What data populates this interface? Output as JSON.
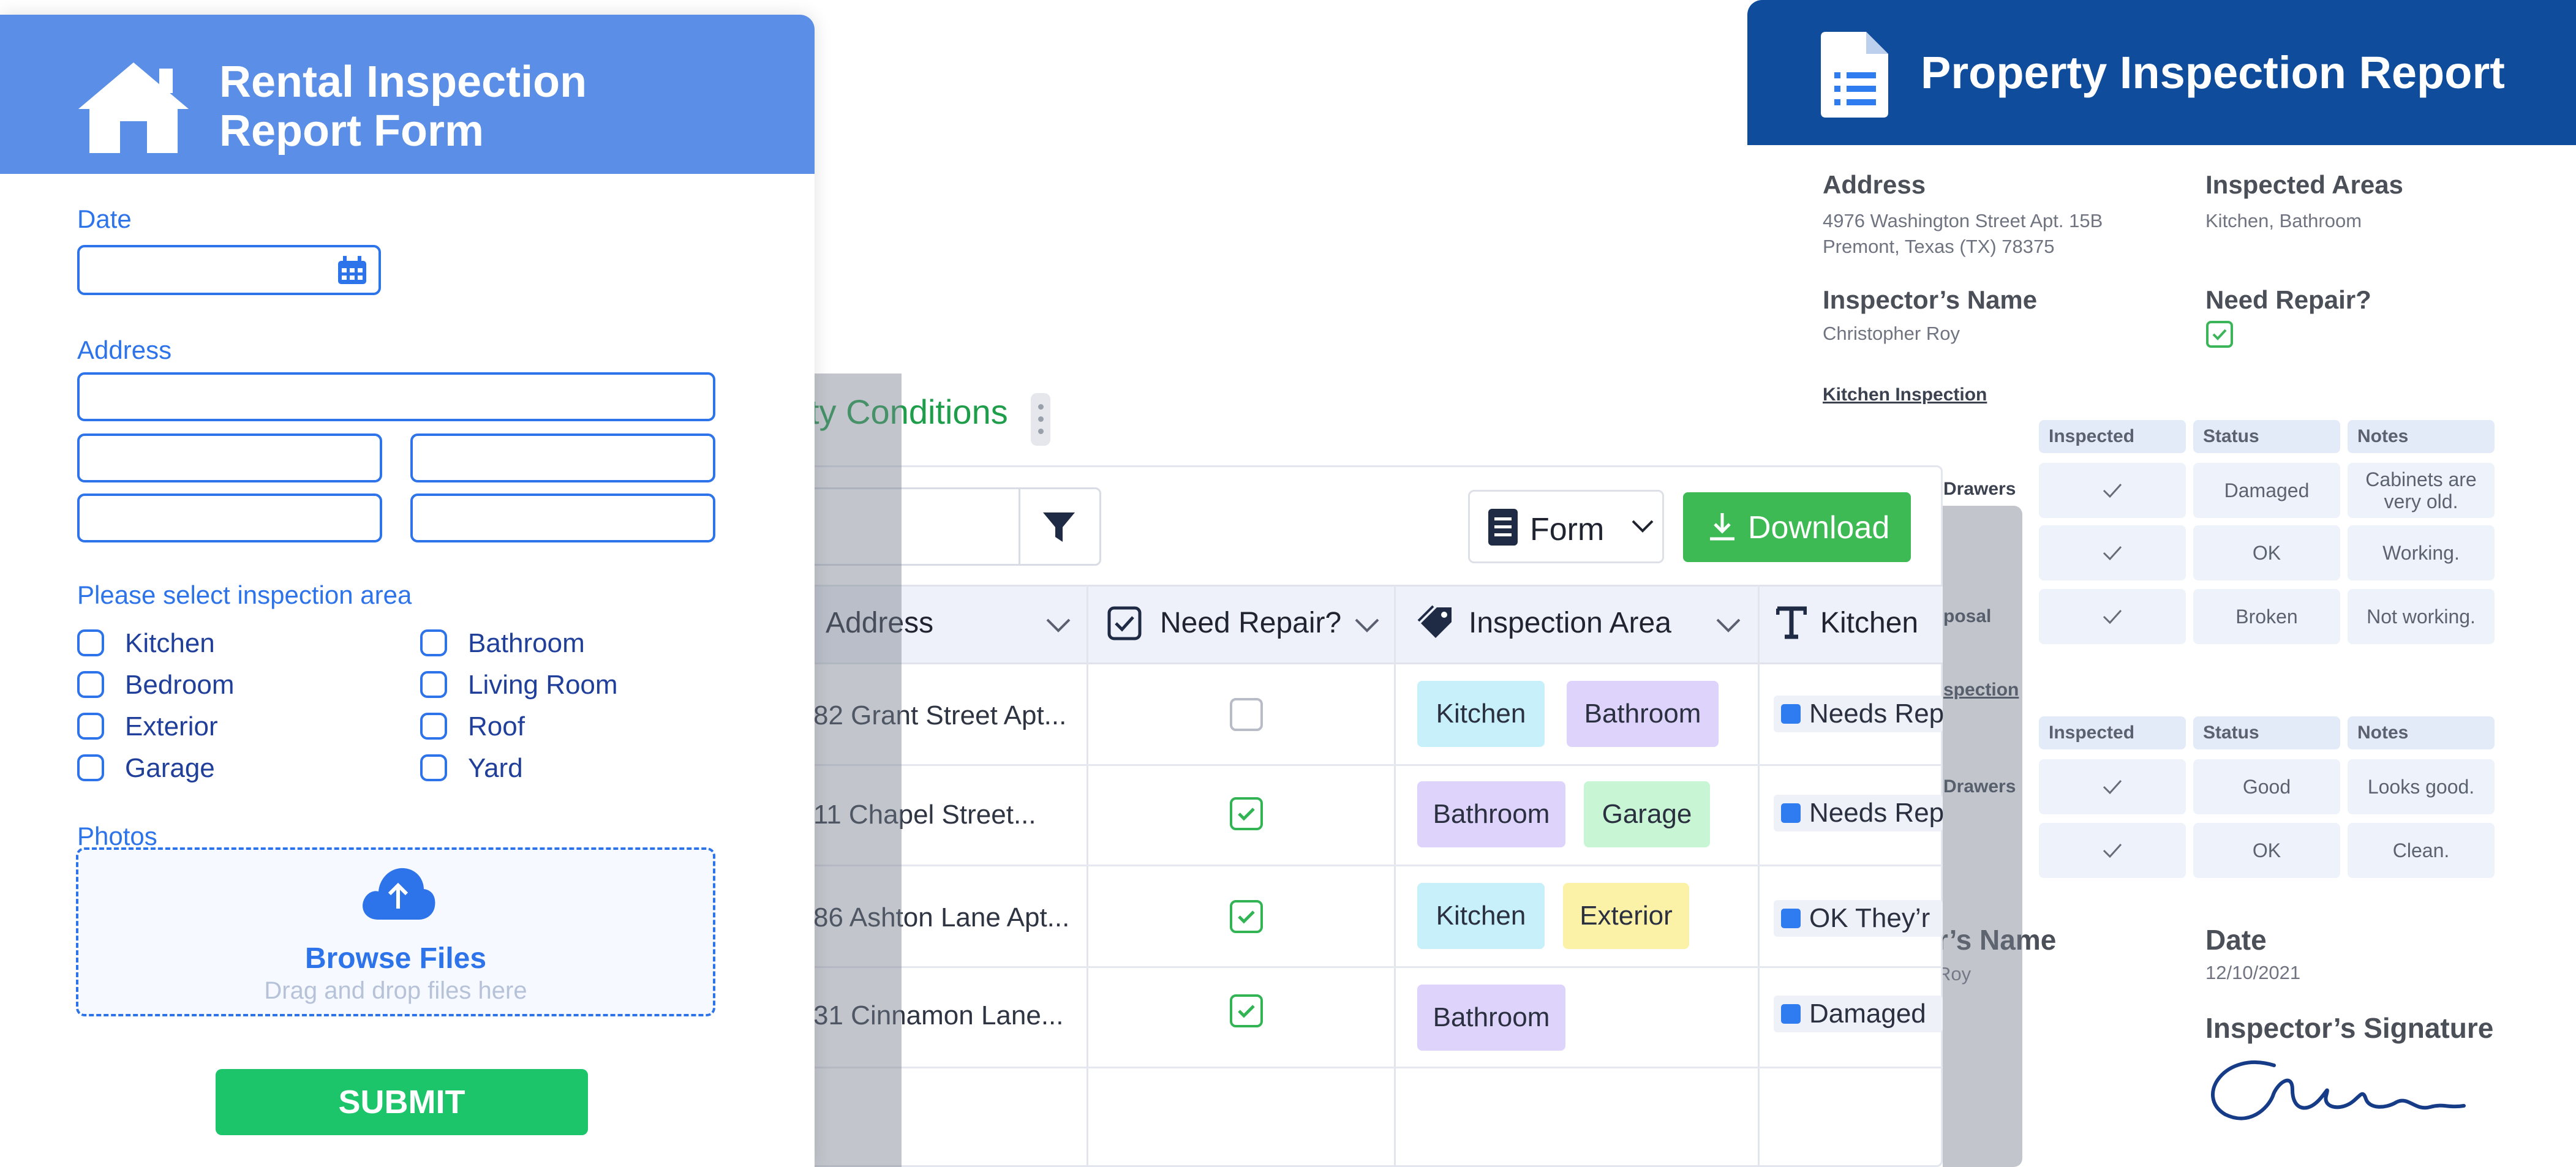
{
  "report": {
    "title": "Property Inspection Report",
    "address_label": "Address",
    "address_line1": "4976 Washington Street Apt. 15B",
    "address_line2": "Premont, Texas (TX) 78375",
    "inspected_areas_label": "Inspected Areas",
    "inspected_areas": "Kitchen, Bathroom",
    "inspector_name_label": "Inspector’s Name",
    "inspector_name": "Christopher Roy",
    "need_repair_label": "Need Repair?",
    "kitchen_section": "Kitchen Inspection",
    "col_inspected": "Inspected",
    "col_status": "Status",
    "col_notes": "Notes",
    "kitchen_rows": [
      {
        "item": "Drawers",
        "status": "Damaged",
        "notes": "Cabinets are very old."
      },
      {
        "item": "",
        "status": "OK",
        "notes": "Working."
      },
      {
        "item": "posal",
        "status": "Broken",
        "notes": "Not working."
      }
    ],
    "bathroom_section": "spection",
    "bathroom_rows": [
      {
        "item": "Drawers",
        "status": "Good",
        "notes": "Looks good."
      },
      {
        "item": "",
        "status": "OK",
        "notes": "Clean."
      }
    ],
    "inspector_name_label2": "r’s Name",
    "inspector_name2": "Roy",
    "date_label": "Date",
    "date": "12/10/2021",
    "signature_label": "Inspector’s Signature"
  },
  "table": {
    "title": "ty Conditions",
    "form_label": "Form",
    "download_label": "Download",
    "columns": [
      "Address",
      "Need Repair?",
      "Inspection Area",
      "Kitchen"
    ],
    "rows": [
      {
        "address": "82 Grant Street Apt...",
        "repair": false,
        "tags": [
          "Kitchen",
          "Bathroom"
        ],
        "kitchen": "Needs Rep"
      },
      {
        "address": "11 Chapel Street...",
        "repair": true,
        "tags": [
          "Bathroom",
          "Garage"
        ],
        "kitchen": "Needs Rep"
      },
      {
        "address": "86 Ashton Lane Apt...",
        "repair": true,
        "tags": [
          "Kitchen",
          "Exterior"
        ],
        "kitchen": "OK  They’r"
      },
      {
        "address": "31 Cinnamon Lane...",
        "repair": true,
        "tags": [
          "Bathroom"
        ],
        "kitchen": "Damaged"
      }
    ],
    "tag_colors": {
      "Kitchen": "#c7f0fb",
      "Bathroom": "#ddd3fb",
      "Garage": "#c8f6d4",
      "Exterior": "#fbf2a8"
    }
  },
  "form": {
    "title_line1": "Rental Inspection",
    "title_line2": "Report Form",
    "date_label": "Date",
    "address_label": "Address",
    "area_label": "Please select inspection area",
    "areas": [
      "Kitchen",
      "Bathroom",
      "Bedroom",
      "Living Room",
      "Exterior",
      "Roof",
      "Garage",
      "Yard"
    ],
    "photos_label": "Photos",
    "browse": "Browse Files",
    "drag": "Drag and drop files here",
    "submit": "SUBMIT"
  },
  "colors": {
    "form_blue": "#2d73ea",
    "report_blue": "#0f4c9c",
    "green": "#3dba53"
  }
}
